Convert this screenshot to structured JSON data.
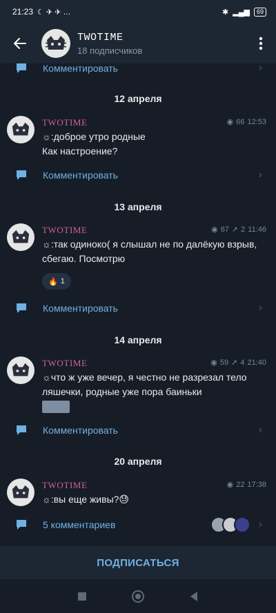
{
  "status_bar": {
    "time": "21:23",
    "icons_left": "☾ ✈ ✈ …",
    "battery": "69"
  },
  "header": {
    "title": "TWOTIME",
    "subscribers": "18 подписчиков"
  },
  "top_comment_label": "Комментировать",
  "posts": [
    {
      "date": "12 апреля",
      "author": "TWOTIME",
      "views": "66",
      "forwards": "",
      "time": "12:53",
      "text": ":доброе утро родные\nКак настроение?",
      "comment_label": "Комментировать"
    },
    {
      "date": "13 апреля",
      "author": "TWOTIME",
      "views": "67",
      "forwards": "2",
      "time": "11:46",
      "text": ":так одиноко( я слышал не по далёкую взрыв, сбегаю. Посмотрю",
      "reaction_emoji": "🔥",
      "reaction_count": "1",
      "comment_label": "Комментировать"
    },
    {
      "date": "14 апреля",
      "author": "TWOTIME",
      "views": "59",
      "forwards": "4",
      "time": "21:40",
      "text": "что ж уже вечер, я честно не разрезал тело ляшечки, родные уже пора баиньки",
      "comment_label": "Комментировать"
    },
    {
      "date": "20 апреля",
      "author": "TWOTIME",
      "views": "22",
      "forwards": "",
      "time": "17:38",
      "text": ":вы еще живы?😓",
      "comment_label": "5 комментариев"
    }
  ],
  "subscribe_label": "ПОДПИСАТЬСЯ",
  "icons": {
    "back": "arrow-left-icon",
    "menu": "more-vertical-icon",
    "comment": "comment-icon",
    "views": "eye-icon",
    "forwards": "forward-icon",
    "chevron": "chevron-right-icon"
  },
  "colors": {
    "background": "#161d26",
    "bar": "#1d2733",
    "accent": "#6fb1e4",
    "author": "#d3609c"
  }
}
